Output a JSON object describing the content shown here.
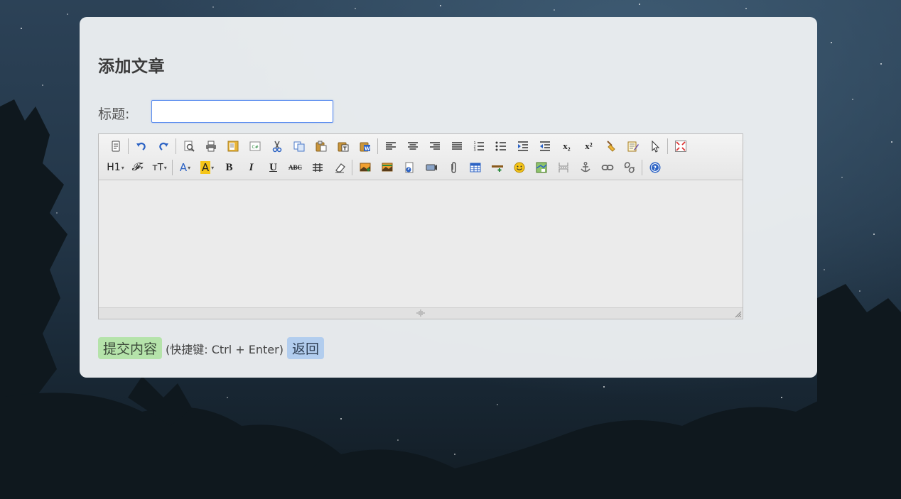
{
  "page": {
    "heading": "添加文章",
    "title_label": "标题:",
    "title_value": "",
    "submit_label": "提交内容",
    "shortcut_hint": "(快捷键: Ctrl + Enter)",
    "back_label": "返回"
  },
  "editor": {
    "content": "",
    "toolbar_row1": [
      "source-icon",
      "undo-icon",
      "redo-icon",
      "preview-icon",
      "print-icon",
      "template-icon",
      "code-icon",
      "cut-icon",
      "copy-icon",
      "paste-icon",
      "paste-text-icon",
      "paste-word-icon",
      "align-left-icon",
      "align-center-icon",
      "align-right-icon",
      "justify-icon",
      "ordered-list-icon",
      "unordered-list-icon",
      "indent-icon",
      "outdent-icon",
      "subscript-icon",
      "superscript-icon",
      "clear-format-icon",
      "quick-format-icon",
      "select-all-icon",
      "fullscreen-icon"
    ],
    "toolbar_row2": [
      "heading-icon",
      "font-family-icon",
      "font-size-icon",
      "font-color-icon",
      "highlight-color-icon",
      "bold-icon",
      "italic-icon",
      "underline-icon",
      "strikethrough-icon",
      "line-height-icon",
      "remove-format-icon",
      "image-icon",
      "multi-image-icon",
      "flash-icon",
      "media-icon",
      "attachment-icon",
      "table-icon",
      "hr-icon",
      "emoticon-icon",
      "baidu-map-icon",
      "page-break-icon",
      "anchor-icon",
      "link-icon",
      "unlink-icon",
      "about-icon"
    ],
    "glyphs": {
      "heading": "H1",
      "font_family": "𝓕",
      "font_size": "тT",
      "font_color": "A",
      "highlight": "A",
      "bold": "B",
      "italic": "I",
      "underline": "U",
      "strikethrough": "ABC",
      "subscript": "x₂",
      "superscript": "x²"
    }
  },
  "colors": {
    "panel_bg": "#edf0f3",
    "submit_bg": "#b5e3aa",
    "back_bg": "#b2cdee",
    "input_border": "#5b8def"
  }
}
